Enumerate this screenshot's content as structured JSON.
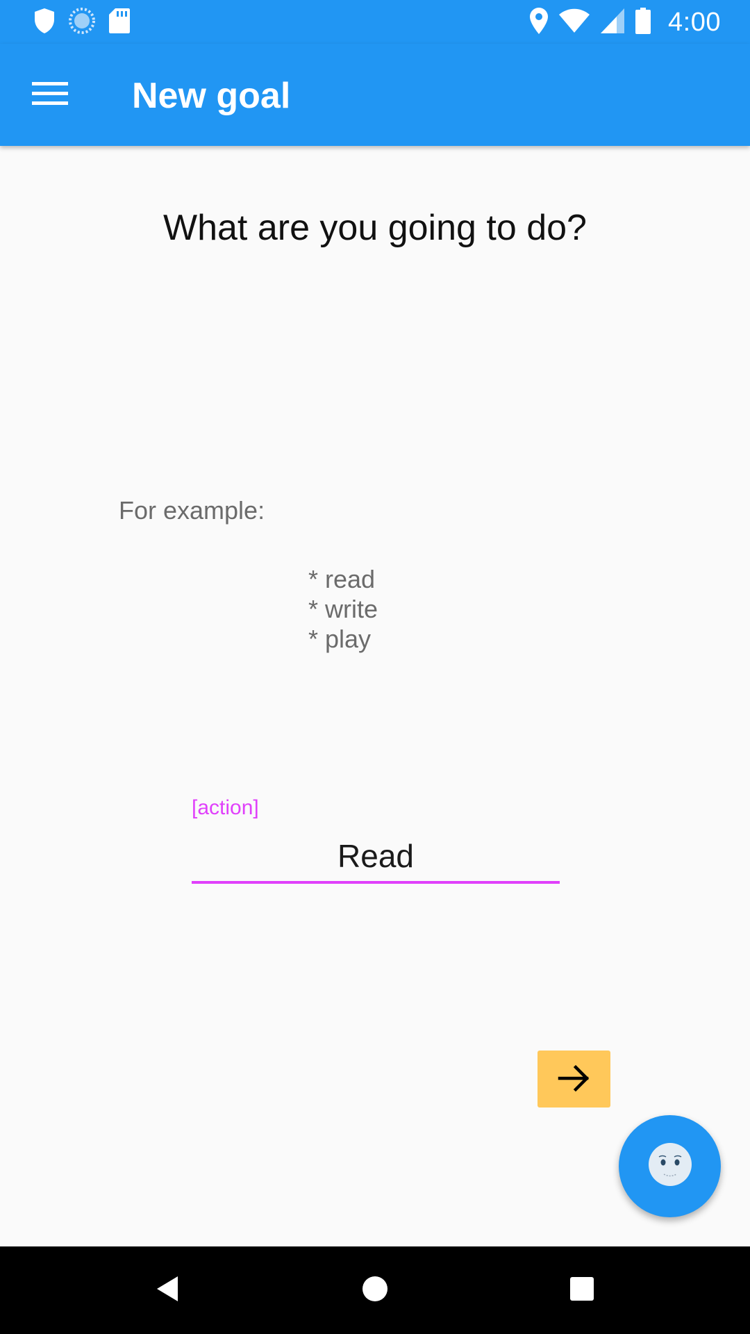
{
  "status_bar": {
    "time": "4:00",
    "left_icons": [
      "shield-icon",
      "sync-icon",
      "sd-card-icon"
    ],
    "right_icons": [
      "location-icon",
      "wifi-icon",
      "cell-signal-icon",
      "battery-icon"
    ]
  },
  "app_bar": {
    "title": "New goal",
    "menu_icon": "hamburger-menu-icon"
  },
  "main": {
    "question": "What are you going to do?",
    "example_label": "For example:",
    "examples": [
      "* read",
      "* write",
      "* play"
    ],
    "field_label": "[action]",
    "input_value": "Read",
    "next_icon": "arrow-right-icon"
  },
  "fab": {
    "icon": "face-icon"
  },
  "nav_bar": {
    "icons": [
      "back-icon",
      "home-icon",
      "recents-icon"
    ]
  },
  "colors": {
    "primary": "#2196f3",
    "accent": "#e040fb",
    "next_button": "#ffc85a",
    "nav_bar": "#000000",
    "background": "#fafafa"
  }
}
